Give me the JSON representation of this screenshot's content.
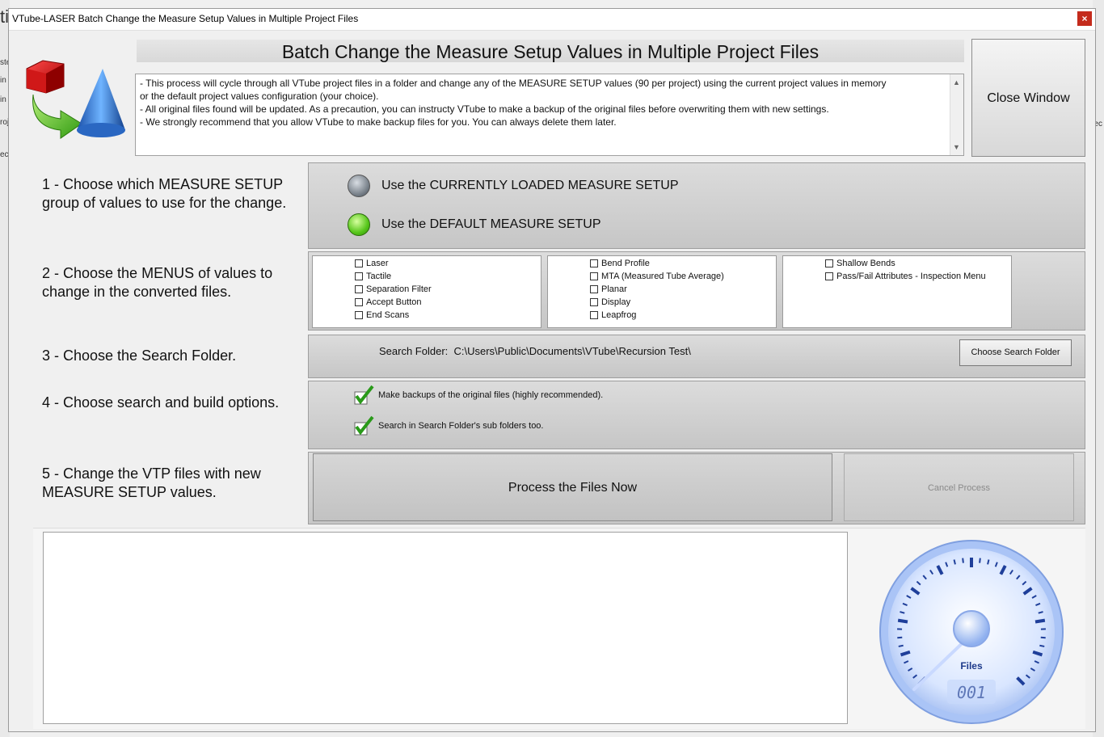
{
  "background": {
    "left_fragments": [
      "ti",
      "ste",
      "in",
      "in",
      "roj",
      "ec"
    ],
    "right_fragments": [
      "ec"
    ]
  },
  "window": {
    "title": "VTube-LASER Batch Change the Measure Setup Values in Multiple Project Files",
    "close_glyph": "×"
  },
  "header": {
    "title": "Batch Change the Measure Setup Values in Multiple Project Files"
  },
  "description": {
    "lines": [
      "- This process will cycle through all VTube project files in a folder and change any of the MEASURE SETUP values (90 per project) using the current project values in memory",
      "or the default project values configuration (your choice).",
      "- All original files found will be updated. As a precaution, you can instructy VTube to make a backup of the original files before overwriting them with new settings.",
      "- We strongly recommend that you allow VTube to make backup files for you. You can always delete them later."
    ]
  },
  "close_window_button": "Close Window",
  "step1": {
    "label_lines": [
      "1 - Choose which MEASURE SETUP",
      "group of values to use for the change."
    ],
    "options": [
      {
        "label": "Use the CURRENTLY LOADED MEASURE SETUP",
        "selected": false
      },
      {
        "label": "Use the DEFAULT MEASURE SETUP",
        "selected": true
      }
    ]
  },
  "step2": {
    "label_lines": [
      "2 - Choose the MENUS of values to",
      "change in the converted files."
    ],
    "groups": [
      [
        "Laser",
        "Tactile",
        "Separation Filter",
        "Accept Button",
        "End Scans"
      ],
      [
        "Bend Profile",
        "MTA (Measured Tube Average)",
        "Planar",
        "Display",
        "Leapfrog"
      ],
      [
        "Shallow Bends",
        "Pass/Fail Attributes - Inspection Menu"
      ]
    ]
  },
  "step3": {
    "label": "3 - Choose the Search Folder.",
    "folder_label": "Search Folder:",
    "folder_path": "C:\\Users\\Public\\Documents\\VTube\\Recursion Test\\",
    "choose_button": "Choose Search Folder"
  },
  "step4": {
    "label": "4 - Choose search and build options.",
    "options": [
      {
        "label": "Make backups of the original files (highly recommended).",
        "checked": true
      },
      {
        "label": "Search in Search Folder's sub folders too.",
        "checked": true
      }
    ]
  },
  "step5": {
    "label_lines": [
      "5 - Change the VTP files with new",
      "MEASURE SETUP values."
    ],
    "process_button": "Process the Files Now",
    "cancel_button": "Cancel Process"
  },
  "gauge": {
    "label": "Files",
    "readout": "001"
  },
  "colors": {
    "accent_green": "#56c61a",
    "gauge_blue": "#a9c3f5",
    "close_red": "#c42b1c"
  }
}
